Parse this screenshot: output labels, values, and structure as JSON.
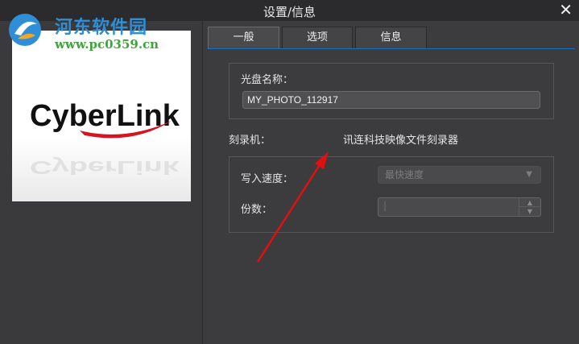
{
  "window": {
    "title": "设置/信息",
    "close_symbol": "✕"
  },
  "watermark": {
    "site_name": "河东软件园",
    "url": "www.pc0359.cn"
  },
  "cover": {
    "brand": "CyberLink"
  },
  "tabs": [
    {
      "label": "一般",
      "active": true
    },
    {
      "label": "选项",
      "active": false
    },
    {
      "label": "信息",
      "active": false
    }
  ],
  "disc": {
    "label": "光盘名称：",
    "value": "MY_PHOTO_112917"
  },
  "burner": {
    "label": "刻录机：",
    "value": "讯连科技映像文件刻录器"
  },
  "write_speed": {
    "label": "写入速度：",
    "selected": "最快速度",
    "arrow": "▼"
  },
  "copies": {
    "label": "份数：",
    "value": "|",
    "up": "▲",
    "down": "▼"
  },
  "colors": {
    "accent": "#1d6fbf",
    "annotation_arrow": "#e01010"
  }
}
